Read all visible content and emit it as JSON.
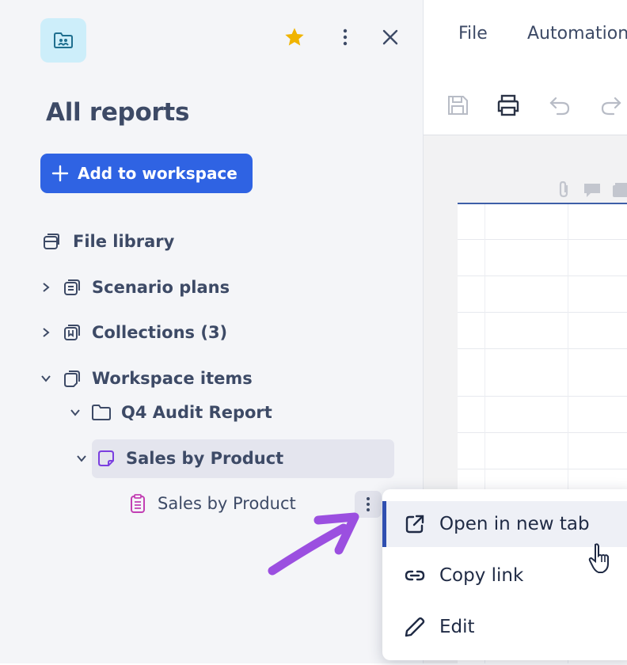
{
  "sidebar": {
    "title": "All reports",
    "add_button_label": "Add to workspace",
    "tree": {
      "file_library": "File library",
      "scenario_plans": "Scenario plans",
      "collections": "Collections (3)",
      "workspace_items": "Workspace items",
      "q4_audit_report": "Q4 Audit Report",
      "sales_by_product_report": "Sales by Product",
      "sales_by_product_sheet": "Sales by Product"
    }
  },
  "menubar": {
    "file": "File",
    "automation": "Automation"
  },
  "context_menu": {
    "items": [
      {
        "label": "Open in new tab",
        "icon": "external-link-icon"
      },
      {
        "label": "Copy link",
        "icon": "link-icon"
      },
      {
        "label": "Edit",
        "icon": "pencil-icon"
      }
    ]
  },
  "colors": {
    "accent": "#2f63e3",
    "star": "#f0b400",
    "arrow": "#9b4fe0",
    "sidebar_bg": "#f4f5f8",
    "report_icon": "#7b3fe0",
    "sheet_icon": "#c23fb3"
  }
}
